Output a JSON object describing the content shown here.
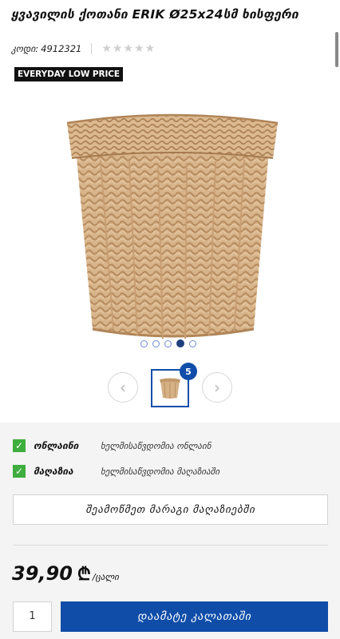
{
  "product": {
    "title": "ყვავილის ქოთანი ERIK Ø25x24სმ ხისფერი",
    "code_label": "კოდი:",
    "code_value": "4912321",
    "rating_stars": 0,
    "badge": "EVERYDAY LOW PRICE"
  },
  "gallery": {
    "slide_count": 5,
    "active_slide": 4,
    "thumb_count": "5"
  },
  "icons": {
    "prev": "chevron-left-icon",
    "next": "chevron-right-icon",
    "check": "check-icon",
    "star": "star-icon"
  },
  "availability": {
    "items": [
      {
        "label": "ონლაინი",
        "value": "ხელმისაწვდომია ონლაინ"
      },
      {
        "label": "მაღაზია",
        "value": "ხელმისაწვდომია მაღაზიაში"
      }
    ],
    "check_stores_label": "შეამოწმეთ მარაგი მაღაზიებში"
  },
  "purchase": {
    "price": "39,90",
    "currency": "₾",
    "unit": "/ცალი",
    "quantity": "1",
    "add_to_cart_label": "დაამატე კალათაში"
  },
  "colors": {
    "accent_blue": "#0f4da8",
    "available_green": "#3dae3d",
    "panel_gray": "#f4f4f4"
  }
}
